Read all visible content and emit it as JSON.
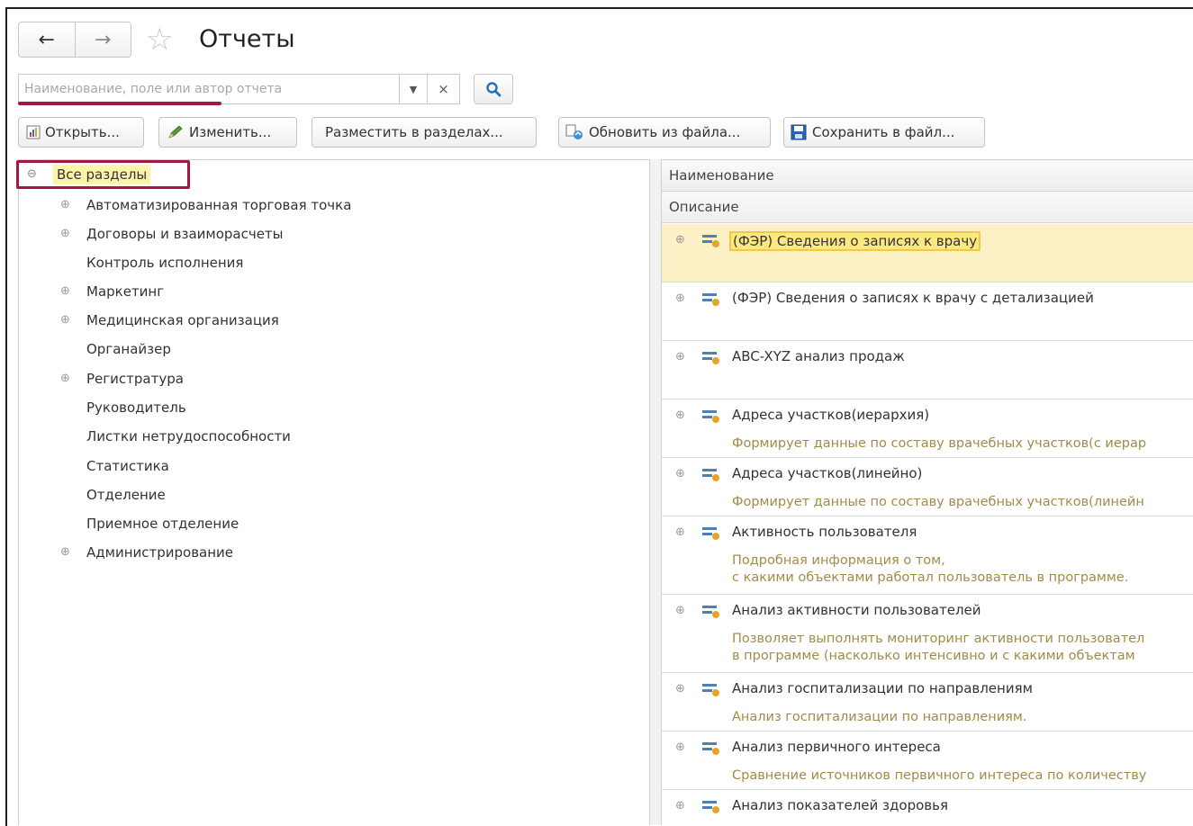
{
  "header": {
    "title": "Отчеты",
    "back_icon": "arrow-left-icon",
    "forward_icon": "arrow-right-icon",
    "favorite_icon": "star-icon"
  },
  "search": {
    "placeholder": "Наименование, поле или автор отчета",
    "value": "",
    "clear_label": "×",
    "dropdown_icon": "chevron-down-icon",
    "search_icon": "magnifier-icon"
  },
  "toolbar": {
    "open_label": "Открыть...",
    "edit_label": "Изменить...",
    "place_label": "Разместить в разделах...",
    "update_label": "Обновить из файла...",
    "save_label": "Сохранить в файл..."
  },
  "sections": {
    "root_label": "Все разделы",
    "items": [
      {
        "label": "Автоматизированная торговая точка",
        "expandable": true
      },
      {
        "label": "Договоры и взаиморасчеты",
        "expandable": true
      },
      {
        "label": "Контроль исполнения",
        "expandable": false
      },
      {
        "label": "Маркетинг",
        "expandable": true
      },
      {
        "label": "Медицинская организация",
        "expandable": true
      },
      {
        "label": "Органайзер",
        "expandable": false
      },
      {
        "label": "Регистратура",
        "expandable": true
      },
      {
        "label": "Руководитель",
        "expandable": false
      },
      {
        "label": "Листки нетрудоспособности",
        "expandable": false
      },
      {
        "label": "Статистика",
        "expandable": false
      },
      {
        "label": "Отделение",
        "expandable": false
      },
      {
        "label": "Приемное отделение",
        "expandable": false
      },
      {
        "label": "Администрирование",
        "expandable": true
      }
    ]
  },
  "reports": {
    "col_name": "Наименование",
    "col_desc": "Описание",
    "items": [
      {
        "name": "(ФЭР) Сведения о записях к врачу",
        "desc1": "",
        "desc2": ""
      },
      {
        "name": "(ФЭР) Сведения о записях к врачу с детализацией",
        "desc1": "",
        "desc2": ""
      },
      {
        "name": "ABC-XYZ анализ продаж",
        "desc1": "",
        "desc2": ""
      },
      {
        "name": "Адреса участков(иерархия)",
        "desc1": "Формирует данные по составу врачебных участков(с иерар",
        "desc2": ""
      },
      {
        "name": "Адреса участков(линейно)",
        "desc1": "Формирует данные по составу врачебных участков(линейн",
        "desc2": ""
      },
      {
        "name": "Активность пользователя",
        "desc1": "Подробная информация о том,",
        "desc2": "с какими объектами работал пользователь в программе."
      },
      {
        "name": "Анализ активности пользователей",
        "desc1": "Позволяет выполнять мониторинг активности пользовател",
        "desc2": "в программе (насколько интенсивно и с какими объектам"
      },
      {
        "name": "Анализ госпитализации по направлениям",
        "desc1": "Анализ госпитализации по направлениям.",
        "desc2": ""
      },
      {
        "name": "Анализ первичного интереса",
        "desc1": "Сравнение источников первичного интереса по количеству",
        "desc2": ""
      },
      {
        "name": "Анализ показателей здоровья",
        "desc1": "",
        "desc2": ""
      }
    ]
  },
  "colors": {
    "highlight_border": "#a01848",
    "selected_row": "#fcf1c4",
    "description_text": "#a08c48",
    "root_highlight": "#fbf5a9"
  }
}
